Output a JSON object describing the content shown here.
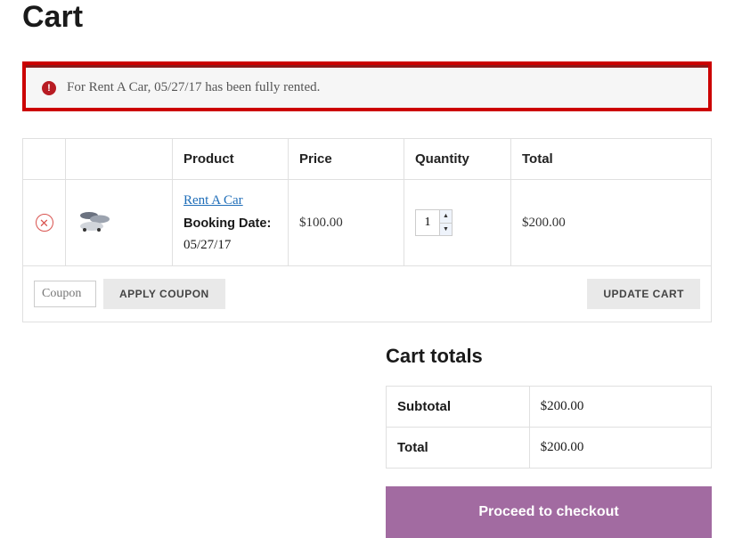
{
  "title": "Cart",
  "alert": {
    "message": "For Rent A Car, 05/27/17 has been fully rented."
  },
  "cart": {
    "headers": {
      "product": "Product",
      "price": "Price",
      "quantity": "Quantity",
      "total": "Total"
    },
    "items": [
      {
        "name": "Rent A Car",
        "meta_label": "Booking Date:",
        "meta_value": "05/27/17",
        "price": "$100.00",
        "qty": "1",
        "total": "$200.00"
      }
    ]
  },
  "actions": {
    "coupon_placeholder": "Coupon",
    "apply_coupon": "APPLY COUPON",
    "update_cart": "UPDATE CART"
  },
  "totals": {
    "title": "Cart totals",
    "rows": {
      "subtotal_label": "Subtotal",
      "subtotal_value": "$200.00",
      "total_label": "Total",
      "total_value": "$200.00"
    },
    "checkout": "Proceed to checkout"
  }
}
